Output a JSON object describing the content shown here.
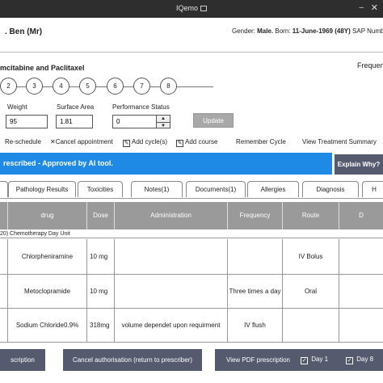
{
  "window": {
    "title": "IQemo"
  },
  "patient": {
    "name": ". Ben (Mr)",
    "gender_label": "Gender:",
    "gender": "Male.",
    "born_label": "Born:",
    "born": "11-June-1969 (48Y)",
    "sap_label": "SAP Numb"
  },
  "regimen": {
    "name": "mcitabine and Paclitaxel",
    "frequency_label": "Frequer"
  },
  "cycles": [
    "2",
    "3",
    "4",
    "5",
    "6",
    "7",
    "8"
  ],
  "form": {
    "weight_label": "Weight",
    "weight_value": "95",
    "surface_label": "Surface Area",
    "surface_value": "1.81",
    "performance_label": "Performance Status",
    "performance_value": "0",
    "update_label": "Update"
  },
  "actions": {
    "reschedule": "Re-schedule",
    "cancel": "Cancel appointment",
    "add_cycles": "Add cycle(s)",
    "add_course": "Add course",
    "remember": "Remember Cycle",
    "summary": "View Treatment Summary"
  },
  "banner": {
    "text": "rescribed - Approved by AI tool.",
    "why_label": "Explain Why?"
  },
  "tabs": [
    "Pathology Results",
    "Toxicities",
    "Notes(1)",
    "Documents(1)",
    "Allergies",
    "Diagnosis",
    "H"
  ],
  "table": {
    "headers": [
      "drug",
      "Dose",
      "Administration",
      "Frequency",
      "Route",
      "D"
    ],
    "unit_row": "20) Chemotherapy Day Unit",
    "rows": [
      {
        "drug": "Chlorpheniramine",
        "dose": "10 mg",
        "administration": "",
        "frequency": "",
        "route": "IV Bolus"
      },
      {
        "drug": "Metoclopramide",
        "dose": "10 mg",
        "administration": "",
        "frequency": "Three times a day",
        "route": "Oral"
      },
      {
        "drug": "Sodium Chloride0.9%",
        "dose": "318mg",
        "administration": "volume dependet upon requirment",
        "frequency": "IV flush",
        "route": ""
      }
    ]
  },
  "bottom": {
    "prescription": "scription",
    "cancel_auth": "Cancel authorisation (return to prescriber)",
    "view_pdf": "View PDF prescription",
    "day1": "Day 1",
    "day8": "Day 8"
  },
  "colors": {
    "banner": "#1e8ae6",
    "button_dark": "#555a6e",
    "header_gray": "#9a9a9a"
  }
}
